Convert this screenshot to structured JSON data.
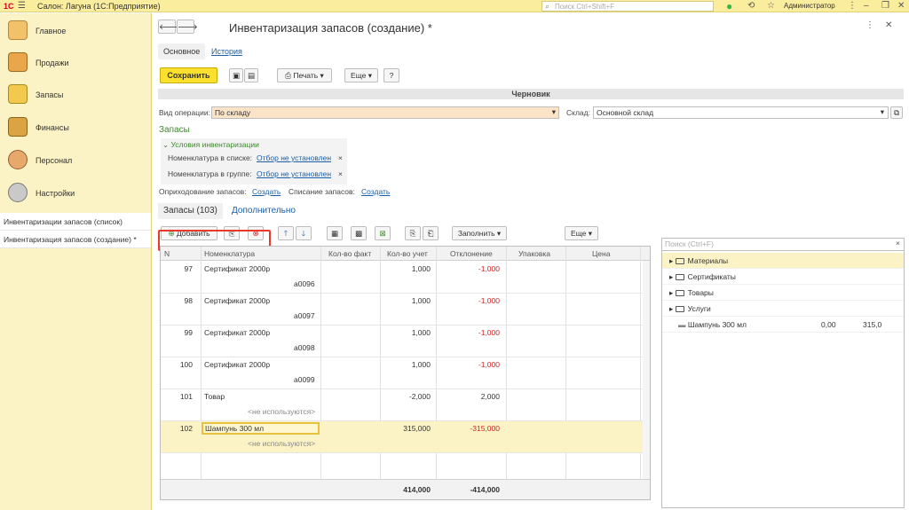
{
  "app": {
    "logo": "1С",
    "title": "Салон: Лагуна  (1С:Предприятие)",
    "search_placeholder": "Поиск Ctrl+Shift+F",
    "user": "Администратор"
  },
  "nav": [
    {
      "label": "Главное",
      "color": "#f2c26b"
    },
    {
      "label": "Продажи",
      "color": "#e9a64a"
    },
    {
      "label": "Запасы",
      "color": "#f2c94c"
    },
    {
      "label": "Финансы",
      "color": "#d9a441"
    },
    {
      "label": "Персонал",
      "color": "#e7a86b"
    },
    {
      "label": "Настройки",
      "color": "#c9c9c9"
    }
  ],
  "open_windows": [
    "Инвентаризации запасов (список)",
    "Инвентаризация запасов (создание) *"
  ],
  "doc": {
    "title": "Инвентаризация запасов (создание) *",
    "tab_main": "Основное",
    "tab_history": "История",
    "save": "Сохранить",
    "print": "Печать",
    "more": "Еще",
    "help": "?",
    "status": "Черновик",
    "op_label": "Вид операции:",
    "op_value": "По складу",
    "wh_label": "Склад:",
    "wh_value": "Основной склад",
    "stock_section": "Запасы",
    "cond_title": "Условия инвентаризации",
    "cond1_label": "Номенклатура в списке:",
    "cond1_value": "Отбор не установлен",
    "cond2_label": "Номенклатура в группе:",
    "cond2_value": "Отбор не установлен",
    "posting_label": "Оприходование запасов:",
    "posting_link": "Создать",
    "writeoff_label": "Списание запасов:",
    "writeoff_link": "Создать",
    "tab_stock": "Запасы (103)",
    "tab_extra": "Дополнительно",
    "add": "Добавить",
    "fill": "Заполнить",
    "more2": "Еще"
  },
  "table": {
    "headers": [
      "N",
      "Номенклатура",
      "Кол-во факт",
      "Кол-во учет",
      "Отклонение",
      "Упаковка",
      "Цена"
    ],
    "rows": [
      {
        "n": "97",
        "name": "Сертификат 2000р",
        "sub": "а0096",
        "fact": "",
        "acc": "1,000",
        "dev": "-1,000"
      },
      {
        "n": "98",
        "name": "Сертификат 2000р",
        "sub": "а0097",
        "fact": "",
        "acc": "1,000",
        "dev": "-1,000"
      },
      {
        "n": "99",
        "name": "Сертификат 2000р",
        "sub": "а0098",
        "fact": "",
        "acc": "1,000",
        "dev": "-1,000"
      },
      {
        "n": "100",
        "name": "Сертификат 2000р",
        "sub": "а0099",
        "fact": "",
        "acc": "1,000",
        "dev": "-1,000"
      },
      {
        "n": "101",
        "name": "Товар",
        "sub": "<не используются>",
        "fact": "",
        "acc": "-2,000",
        "dev": "2,000"
      },
      {
        "n": "102",
        "name": "Шампунь 300 мл",
        "sub": "<не используются>",
        "fact": "",
        "acc": "315,000",
        "dev": "-315,000"
      }
    ],
    "total_acc": "414,000",
    "total_dev": "-414,000"
  },
  "right": {
    "search_placeholder": "Поиск (Ctrl+F)",
    "items": [
      {
        "label": "Материалы",
        "type": "folder"
      },
      {
        "label": "Сертификаты",
        "type": "folder"
      },
      {
        "label": "Товары",
        "type": "folder"
      },
      {
        "label": "Услуги",
        "type": "folder"
      },
      {
        "label": "Шампунь 300 мл",
        "type": "item",
        "v1": "0,00",
        "v2": "315,0"
      }
    ]
  }
}
